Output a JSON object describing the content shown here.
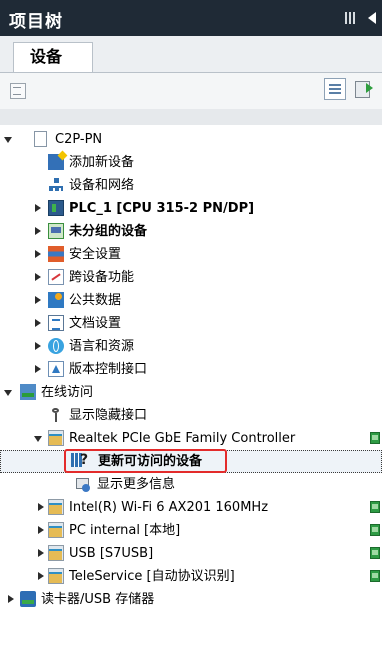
{
  "panel": {
    "title": "项目树"
  },
  "tabs": [
    {
      "label": "设备"
    }
  ],
  "tree": {
    "root": "C2P-PN",
    "items": [
      {
        "label": "添加新设备"
      },
      {
        "label": "设备和网络"
      },
      {
        "label": "PLC_1 [CPU 315-2 PN/DP]"
      },
      {
        "label": "未分组的设备"
      },
      {
        "label": "安全设置"
      },
      {
        "label": "跨设备功能"
      },
      {
        "label": "公共数据"
      },
      {
        "label": "文档设置"
      },
      {
        "label": "语言和资源"
      },
      {
        "label": "版本控制接口"
      },
      {
        "label": "在线访问"
      },
      {
        "label": "显示隐藏接口"
      },
      {
        "label": "Realtek PCIe GbE Family Controller"
      },
      {
        "label": "更新可访问的设备"
      },
      {
        "label": "显示更多信息"
      },
      {
        "label": "Intel(R) Wi-Fi 6 AX201 160MHz"
      },
      {
        "label": "PC internal [本地]"
      },
      {
        "label": "USB [S7USB]"
      },
      {
        "label": "TeleService [自动协议识别]"
      },
      {
        "label": "读卡器/USB 存储器"
      }
    ]
  },
  "colors": {
    "header_bg": "#1f2a36",
    "highlight_box": "#e32b2b",
    "selection_bg": "#eef3f8"
  },
  "icons": {
    "header": [
      "pin-icon",
      "collapse-arrow-icon"
    ],
    "toolbar": [
      "device-toolbar-icon",
      "overview-icon",
      "export-icon"
    ]
  }
}
